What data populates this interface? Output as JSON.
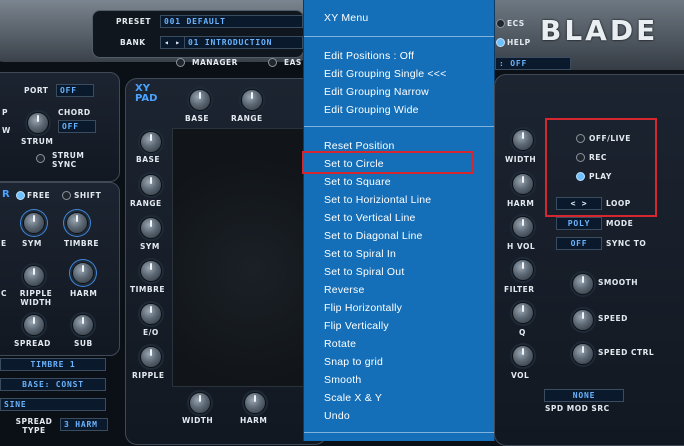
{
  "header": {
    "preset_label": "PRESET",
    "preset_value": "001 DEFAULT",
    "bank_label": "BANK",
    "bank_arrows": "◂ ▸",
    "bank_value": "01 INTRODUCTION",
    "manager_label": "MANAGER",
    "eas_label": "EAS",
    "ecs_label": "ECS",
    "help_label": "HELP",
    "brand": "BLADE",
    "top_right_lcd": ": OFF"
  },
  "left_panel": {
    "port_label": "PORT",
    "port_value": "OFF",
    "chord_label": "CHORD",
    "chord_value": "OFF",
    "strum_label": "STRUM",
    "strum_sync_label": "STRUM SYNC",
    "p_label": "P",
    "w_label": "W",
    "mode_prefix": "R",
    "free_label": "FREE",
    "shift_label": "SHIFT",
    "e_label": "E",
    "sym_label": "SYM",
    "timbre_label": "TIMBRE",
    "c_label": "C",
    "ripple_width_label": "RIPPLE WIDTH",
    "harm_label": "HARM",
    "spread_label": "SPREAD",
    "sub_label": "SUB",
    "timbre_select": "TIMBRE 1",
    "base_select": "BASE: CONST",
    "sine_select": "SINE",
    "spread_type_label": "SPREAD TYPE",
    "spread_type_value": "3 HARM"
  },
  "xy_pad": {
    "title": "XY PAD",
    "top_knobs": [
      "BASE",
      "RANGE"
    ],
    "side_knobs": [
      "BASE",
      "RANGE",
      "SYM",
      "TIMBRE",
      "E/O",
      "RIPPLE"
    ],
    "bottom_knobs": [
      "WIDTH",
      "HARM"
    ]
  },
  "menu": {
    "title": "XY Menu",
    "group1": [
      "Edit Positions : Off",
      "Edit Grouping Single <<<",
      "Edit Grouping Narrow",
      "Edit Grouping Wide"
    ],
    "group2": [
      "Reset Position",
      "Set to Circle",
      "Set to Square",
      "Set to Horiziontal Line",
      "Set to Vertical Line",
      "Set to Diagonal Line",
      "Set to Spiral In",
      "Set to Spiral Out",
      "Reverse",
      "Flip Horizontally",
      "Flip Vertically",
      "Rotate",
      "Snap to grid",
      "Smooth",
      "Scale X & Y",
      "Undo"
    ],
    "highlighted": "Set to Circle"
  },
  "right_panel": {
    "knobs": [
      "WIDTH",
      "HARM",
      "H VOL",
      "FILTER",
      "Q",
      "VOL"
    ],
    "off_live_label": "OFF/LIVE",
    "rec_label": "REC",
    "play_label": "PLAY",
    "loop_arrows": "< >",
    "loop_label": "LOOP",
    "mode_value": "POLY",
    "mode_label": "MODE",
    "sync_value": "OFF",
    "sync_label": "SYNC TO",
    "smooth_label": "SMOOTH",
    "speed_label": "SPEED",
    "speed_ctrl_label": "SPEED CTRL",
    "spd_mod_value": "NONE",
    "spd_mod_label": "SPD MOD SRC"
  },
  "colors": {
    "menu_bg": "#156fb8",
    "highlight_box": "#d4272f",
    "lcd_text": "#69b3ff"
  }
}
